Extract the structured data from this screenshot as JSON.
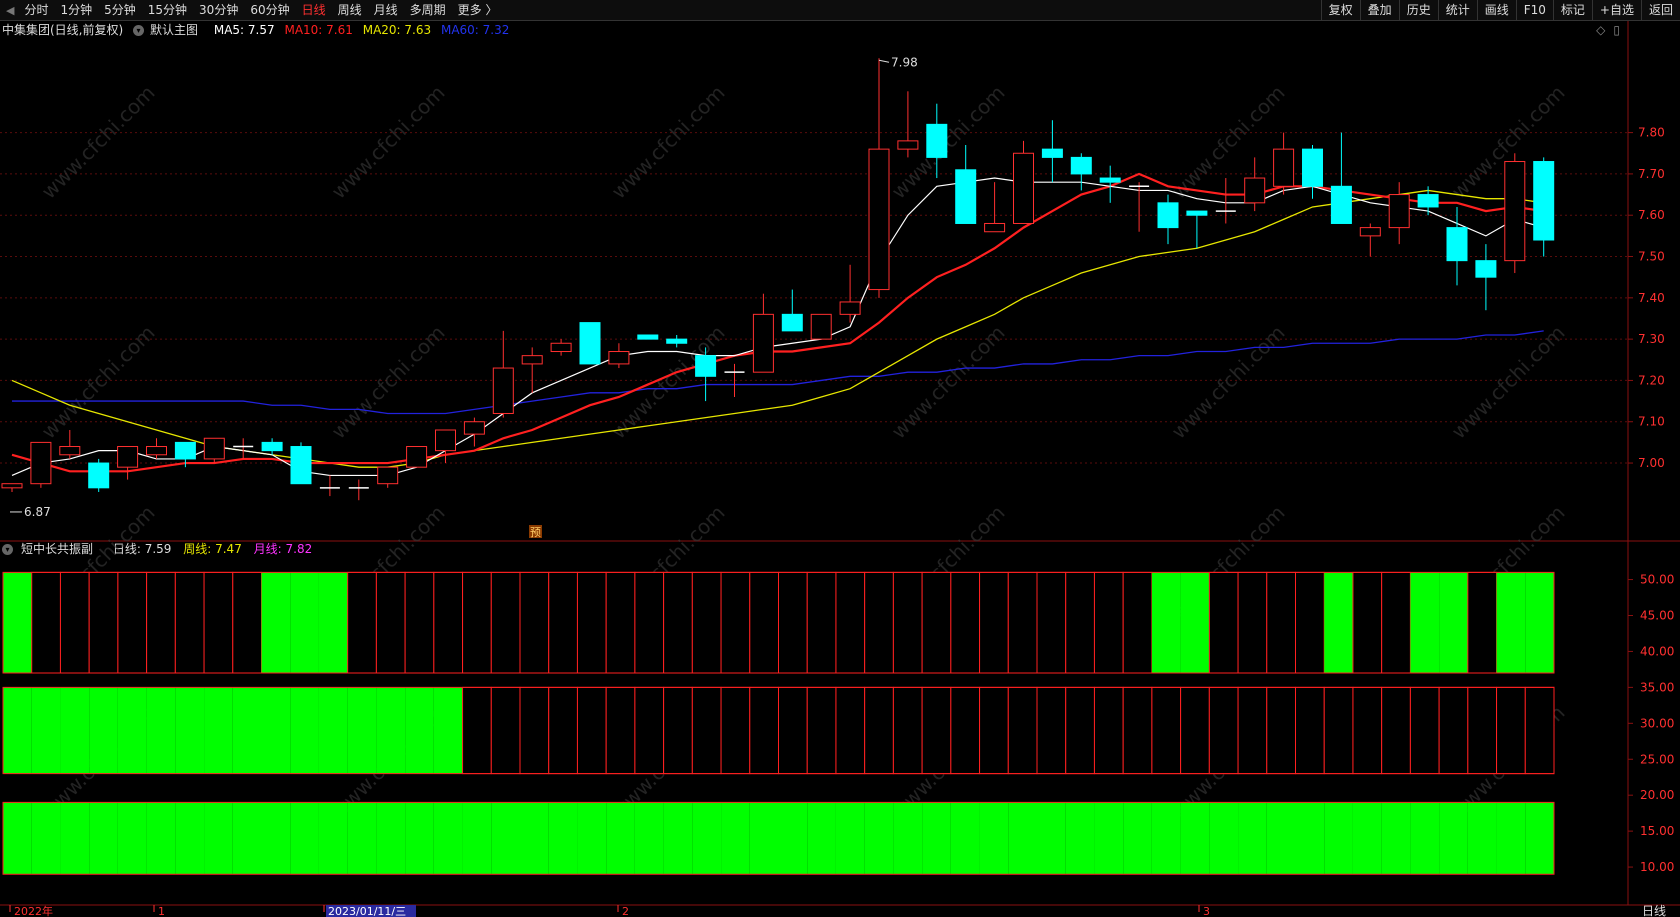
{
  "toolbar": {
    "edge_icon": "◀",
    "tabs": [
      "分时",
      "1分钟",
      "5分钟",
      "15分钟",
      "30分钟",
      "60分钟",
      "日线",
      "周线",
      "月线",
      "多周期",
      "更多 〉"
    ],
    "active_tab": "日线",
    "right_tools": [
      "复权",
      "叠加",
      "历史",
      "统计",
      "画线",
      "F10",
      "标记",
      "+自选",
      "返回"
    ]
  },
  "main_info": {
    "stock": "中集集团(日线,前复权)",
    "template": "默认主图",
    "ma5": "MA5: 7.57",
    "ma10": "MA10: 7.61",
    "ma20": "MA20: 7.63",
    "ma60": "MA60: 7.32",
    "colors": {
      "ma5": "#ffffff",
      "ma10": "#ff2020",
      "ma20": "#e6e600",
      "ma60": "#2222dd"
    }
  },
  "sub_info": {
    "name": "短中长共振副",
    "daily": "日线: 7.59",
    "weekly": "周线: 7.47",
    "monthly": "月线: 7.82",
    "colors": {
      "weekly": "#e6e600",
      "monthly": "#ff33ff"
    }
  },
  "annotations": {
    "high": "7.98",
    "low": "6.87",
    "pre_mark": "预"
  },
  "right_axis_main": [
    "7.80",
    "7.70",
    "7.60",
    "7.50",
    "7.40",
    "7.30",
    "7.20",
    "7.10",
    "7.00"
  ],
  "right_axis_sub": [
    "50.00",
    "45.00",
    "40.00",
    "35.00",
    "30.00",
    "25.00",
    "20.00",
    "15.00",
    "10.00"
  ],
  "bottom_axis": {
    "labels": [
      "2022年",
      "1",
      "2023/01/11/三",
      "2",
      "3"
    ],
    "period": "日线"
  },
  "watermark": "www.cfchi.com",
  "chart_data": {
    "type": "candlestick",
    "ylim": [
      6.85,
      8.0
    ],
    "candles": [
      {
        "o": 6.94,
        "h": 6.95,
        "l": 6.93,
        "c": 6.95
      },
      {
        "o": 6.95,
        "h": 7.05,
        "l": 6.94,
        "c": 7.05
      },
      {
        "o": 7.02,
        "h": 7.08,
        "l": 7.01,
        "c": 7.04
      },
      {
        "o": 7.0,
        "h": 7.01,
        "l": 6.93,
        "c": 6.94
      },
      {
        "o": 6.99,
        "h": 7.04,
        "l": 6.96,
        "c": 7.04
      },
      {
        "o": 7.02,
        "h": 7.06,
        "l": 7.01,
        "c": 7.04
      },
      {
        "o": 7.05,
        "h": 7.05,
        "l": 6.99,
        "c": 7.01
      },
      {
        "o": 7.01,
        "h": 7.06,
        "l": 7.0,
        "c": 7.06
      },
      {
        "o": 7.04,
        "h": 7.06,
        "l": 7.01,
        "c": 7.04
      },
      {
        "o": 7.05,
        "h": 7.06,
        "l": 7.02,
        "c": 7.03
      },
      {
        "o": 7.04,
        "h": 7.05,
        "l": 6.95,
        "c": 6.95
      },
      {
        "o": 6.94,
        "h": 6.97,
        "l": 6.92,
        "c": 6.94
      },
      {
        "o": 6.94,
        "h": 6.96,
        "l": 6.91,
        "c": 6.94
      },
      {
        "o": 6.95,
        "h": 6.99,
        "l": 6.94,
        "c": 6.99
      },
      {
        "o": 6.99,
        "h": 7.04,
        "l": 6.99,
        "c": 7.04
      },
      {
        "o": 7.03,
        "h": 7.08,
        "l": 7.0,
        "c": 7.08
      },
      {
        "o": 7.07,
        "h": 7.11,
        "l": 7.04,
        "c": 7.1
      },
      {
        "o": 7.12,
        "h": 7.32,
        "l": 7.11,
        "c": 7.23
      },
      {
        "o": 7.24,
        "h": 7.28,
        "l": 7.17,
        "c": 7.26
      },
      {
        "o": 7.27,
        "h": 7.3,
        "l": 7.26,
        "c": 7.29
      },
      {
        "o": 7.34,
        "h": 7.34,
        "l": 7.24,
        "c": 7.24
      },
      {
        "o": 7.24,
        "h": 7.29,
        "l": 7.23,
        "c": 7.27
      },
      {
        "o": 7.31,
        "h": 7.31,
        "l": 7.3,
        "c": 7.3
      },
      {
        "o": 7.3,
        "h": 7.31,
        "l": 7.28,
        "c": 7.29
      },
      {
        "o": 7.26,
        "h": 7.28,
        "l": 7.15,
        "c": 7.21
      },
      {
        "o": 7.22,
        "h": 7.24,
        "l": 7.16,
        "c": 7.22
      },
      {
        "o": 7.22,
        "h": 7.41,
        "l": 7.22,
        "c": 7.36
      },
      {
        "o": 7.36,
        "h": 7.42,
        "l": 7.32,
        "c": 7.32
      },
      {
        "o": 7.3,
        "h": 7.36,
        "l": 7.3,
        "c": 7.36
      },
      {
        "o": 7.36,
        "h": 7.48,
        "l": 7.34,
        "c": 7.39
      },
      {
        "o": 7.42,
        "h": 7.98,
        "l": 7.4,
        "c": 7.76
      },
      {
        "o": 7.76,
        "h": 7.9,
        "l": 7.74,
        "c": 7.78
      },
      {
        "o": 7.82,
        "h": 7.87,
        "l": 7.69,
        "c": 7.74
      },
      {
        "o": 7.71,
        "h": 7.77,
        "l": 7.58,
        "c": 7.58
      },
      {
        "o": 7.56,
        "h": 7.68,
        "l": 7.56,
        "c": 7.58
      },
      {
        "o": 7.58,
        "h": 7.78,
        "l": 7.58,
        "c": 7.75
      },
      {
        "o": 7.76,
        "h": 7.83,
        "l": 7.68,
        "c": 7.74
      },
      {
        "o": 7.74,
        "h": 7.75,
        "l": 7.66,
        "c": 7.7
      },
      {
        "o": 7.69,
        "h": 7.72,
        "l": 7.63,
        "c": 7.68
      },
      {
        "o": 7.67,
        "h": 7.68,
        "l": 7.56,
        "c": 7.67
      },
      {
        "o": 7.63,
        "h": 7.65,
        "l": 7.53,
        "c": 7.57
      },
      {
        "o": 7.61,
        "h": 7.61,
        "l": 7.52,
        "c": 7.6
      },
      {
        "o": 7.61,
        "h": 7.69,
        "l": 7.58,
        "c": 7.61
      },
      {
        "o": 7.63,
        "h": 7.74,
        "l": 7.61,
        "c": 7.69
      },
      {
        "o": 7.67,
        "h": 7.8,
        "l": 7.65,
        "c": 7.76
      },
      {
        "o": 7.76,
        "h": 7.77,
        "l": 7.64,
        "c": 7.67
      },
      {
        "o": 7.67,
        "h": 7.8,
        "l": 7.58,
        "c": 7.58
      },
      {
        "o": 7.55,
        "h": 7.58,
        "l": 7.5,
        "c": 7.57
      },
      {
        "o": 7.57,
        "h": 7.68,
        "l": 7.53,
        "c": 7.65
      },
      {
        "o": 7.65,
        "h": 7.67,
        "l": 7.6,
        "c": 7.62
      },
      {
        "o": 7.57,
        "h": 7.62,
        "l": 7.43,
        "c": 7.49
      },
      {
        "o": 7.49,
        "h": 7.53,
        "l": 7.37,
        "c": 7.45
      },
      {
        "o": 7.49,
        "h": 7.75,
        "l": 7.46,
        "c": 7.73
      },
      {
        "o": 7.73,
        "h": 7.74,
        "l": 7.5,
        "c": 7.54
      }
    ],
    "ma5": [
      6.97,
      7.0,
      7.01,
      7.03,
      7.03,
      7.01,
      7.01,
      7.04,
      7.03,
      7.02,
      6.98,
      6.97,
      6.97,
      6.97,
      6.99,
      7.03,
      7.07,
      7.12,
      7.17,
      7.2,
      7.23,
      7.26,
      7.27,
      7.27,
      7.26,
      7.26,
      7.28,
      7.29,
      7.3,
      7.33,
      7.49,
      7.6,
      7.67,
      7.68,
      7.69,
      7.68,
      7.68,
      7.68,
      7.67,
      7.66,
      7.66,
      7.64,
      7.63,
      7.63,
      7.66,
      7.67,
      7.65,
      7.63,
      7.62,
      7.61,
      7.58,
      7.55,
      7.59,
      7.57
    ],
    "ma10": [
      7.02,
      7.0,
      6.98,
      6.98,
      6.98,
      6.99,
      7.0,
      7.0,
      7.01,
      7.01,
      7.0,
      7.0,
      7.0,
      7.0,
      7.01,
      7.02,
      7.03,
      7.06,
      7.08,
      7.11,
      7.14,
      7.16,
      7.19,
      7.22,
      7.24,
      7.26,
      7.27,
      7.27,
      7.28,
      7.29,
      7.34,
      7.4,
      7.45,
      7.48,
      7.52,
      7.57,
      7.61,
      7.65,
      7.67,
      7.7,
      7.67,
      7.66,
      7.65,
      7.65,
      7.67,
      7.67,
      7.66,
      7.65,
      7.64,
      7.63,
      7.63,
      7.61,
      7.62,
      7.61
    ],
    "ma20": [
      7.2,
      7.17,
      7.14,
      7.12,
      7.1,
      7.08,
      7.06,
      7.04,
      7.03,
      7.02,
      7.01,
      7.0,
      6.99,
      6.99,
      7.0,
      7.02,
      7.03,
      7.04,
      7.05,
      7.06,
      7.07,
      7.08,
      7.09,
      7.1,
      7.11,
      7.12,
      7.13,
      7.14,
      7.16,
      7.18,
      7.22,
      7.26,
      7.3,
      7.33,
      7.36,
      7.4,
      7.43,
      7.46,
      7.48,
      7.5,
      7.51,
      7.52,
      7.54,
      7.56,
      7.59,
      7.62,
      7.63,
      7.64,
      7.65,
      7.66,
      7.65,
      7.64,
      7.64,
      7.63
    ],
    "ma60": [
      7.15,
      7.15,
      7.15,
      7.15,
      7.15,
      7.15,
      7.15,
      7.15,
      7.15,
      7.14,
      7.14,
      7.13,
      7.13,
      7.12,
      7.12,
      7.12,
      7.13,
      7.14,
      7.15,
      7.16,
      7.17,
      7.17,
      7.18,
      7.18,
      7.19,
      7.19,
      7.19,
      7.19,
      7.2,
      7.21,
      7.21,
      7.22,
      7.22,
      7.23,
      7.23,
      7.24,
      7.24,
      7.25,
      7.25,
      7.26,
      7.26,
      7.27,
      7.27,
      7.28,
      7.28,
      7.29,
      7.29,
      7.29,
      7.3,
      7.3,
      7.3,
      7.31,
      7.31,
      7.32
    ],
    "resonance_bands": {
      "ylim": [
        5,
        53
      ],
      "short_active": [
        1,
        0,
        0,
        0,
        0,
        0,
        0,
        0,
        0,
        1,
        1,
        1,
        0,
        0,
        0,
        0,
        0,
        0,
        0,
        0,
        0,
        0,
        0,
        0,
        0,
        0,
        0,
        0,
        0,
        0,
        0,
        0,
        0,
        0,
        0,
        0,
        0,
        0,
        0,
        0,
        1,
        1,
        0,
        0,
        0,
        0,
        1,
        0,
        0,
        1,
        1,
        0,
        1,
        1
      ],
      "medium_active": [
        1,
        1,
        1,
        1,
        1,
        1,
        1,
        1,
        1,
        1,
        1,
        1,
        1,
        1,
        1,
        1,
        0,
        0,
        0,
        0,
        0,
        0,
        0,
        0,
        0,
        0,
        0,
        0,
        0,
        0,
        0,
        0,
        0,
        0,
        0,
        0,
        0,
        0,
        0,
        0,
        0,
        0,
        0,
        0,
        0,
        0,
        0,
        0,
        0,
        0,
        0,
        0,
        0,
        0
      ],
      "long_active": [
        1,
        1,
        1,
        1,
        1,
        1,
        1,
        1,
        1,
        1,
        1,
        1,
        1,
        1,
        1,
        1,
        1,
        1,
        1,
        1,
        1,
        1,
        1,
        1,
        1,
        1,
        1,
        1,
        1,
        1,
        1,
        1,
        1,
        1,
        1,
        1,
        1,
        1,
        1,
        1,
        1,
        1,
        1,
        1,
        1,
        1,
        1,
        1,
        1,
        1,
        1,
        1,
        1,
        1
      ],
      "short_range": [
        37,
        51
      ],
      "medium_range": [
        23,
        35
      ],
      "long_range": [
        9,
        19
      ]
    },
    "colors": {
      "up": "#ff3030",
      "down": "#00ffff",
      "band_on": "#00ff00",
      "band_border": "#ff2020",
      "grid": "#8a1010"
    }
  }
}
